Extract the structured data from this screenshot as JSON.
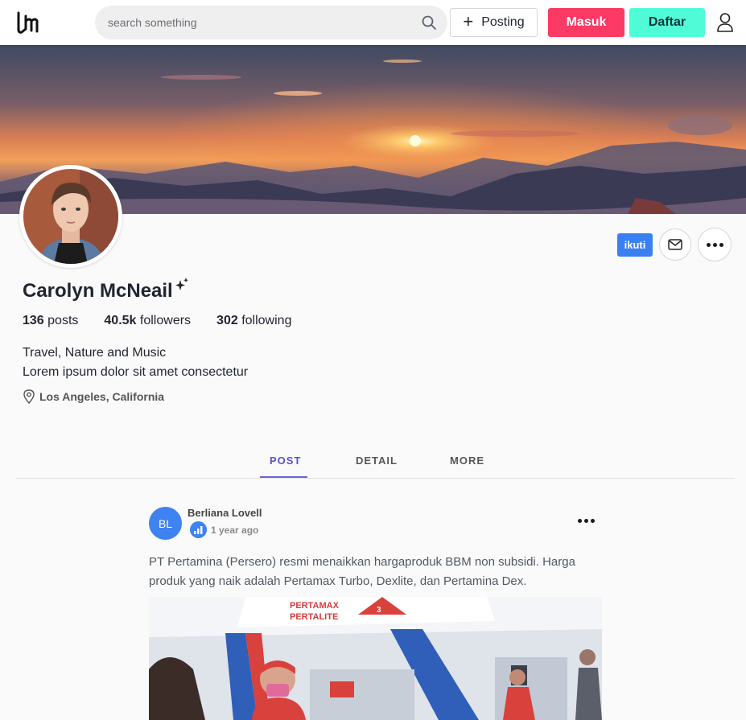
{
  "header": {
    "search_placeholder": "search something",
    "posting_label": "Posting",
    "masuk_label": "Masuk",
    "daftar_label": "Daftar"
  },
  "profile": {
    "name": "Carolyn McNeail",
    "follow_label": "ikuti",
    "stats": {
      "posts_count": "136",
      "posts_label": "posts",
      "followers_count": "40.5k",
      "followers_label": "followers",
      "following_count": "302",
      "following_label": "following"
    },
    "bio_line1": "Travel, Nature and Music",
    "bio_line2": "Lorem ipsum dolor sit amet consectetur",
    "location": "Los Angeles, California"
  },
  "tabs": [
    {
      "label": "POST",
      "active": true
    },
    {
      "label": "DETAIL",
      "active": false
    },
    {
      "label": "MORE",
      "active": false
    }
  ],
  "post": {
    "avatar_initials": "BL",
    "author": "Berliana Lovell",
    "time": "1 year ago",
    "text": "PT Pertamina (Persero) resmi menaikkan hargaproduk BBM non subsidi. Harga produk yang naik adalah Pertamax Turbo, Dexlite, dan Pertamina Dex.",
    "image_sign_1": "PERTAMAX",
    "image_sign_2": "PERTALITE"
  },
  "colors": {
    "masuk": "#fc3a64",
    "daftar": "#4ffcd7",
    "follow": "#3a80f2",
    "tab_active": "#5a50d6",
    "post_avatar": "#3e83f0"
  },
  "icons": [
    "logo-icon",
    "search-icon",
    "plus-icon",
    "user-icon",
    "mail-icon",
    "more-icon",
    "sparkle-icon",
    "location-pin-icon",
    "chart-badge-icon"
  ]
}
